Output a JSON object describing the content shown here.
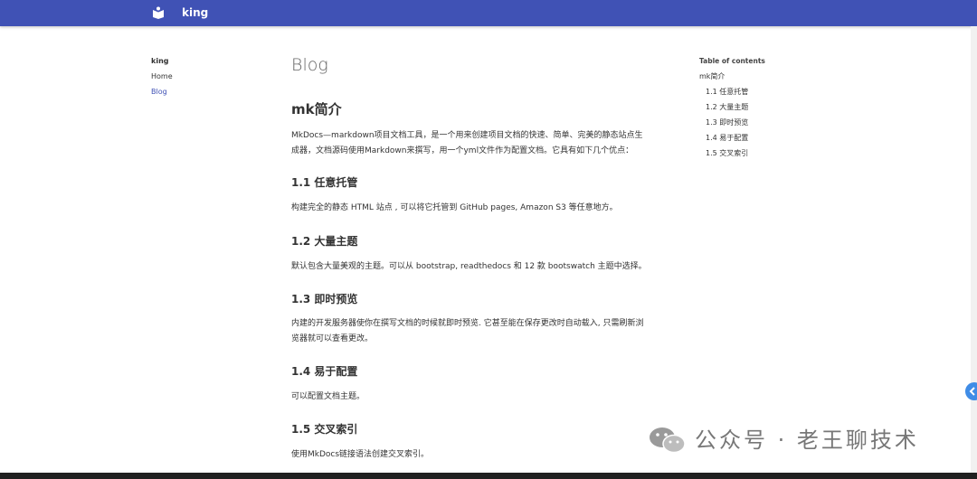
{
  "header": {
    "site_name": "king"
  },
  "nav": {
    "title": "king",
    "items": [
      {
        "label": "Home"
      },
      {
        "label": "Blog"
      }
    ]
  },
  "content": {
    "page_title": "Blog",
    "heading": "mk简介",
    "intro_line1": "MkDocs—markdown项目文档工具，是一个用来创建项目文档的快速、简单、完美的静态站点生",
    "intro_line2": "成器，文档源码使用Markdown来撰写，用一个yml文件作为配置文档。它具有如下几个优点：",
    "sections": [
      {
        "title": "1.1 任意托管",
        "text": [
          "构建完全的静态 HTML 站点 , 可以将它托管到 GitHub pages, Amazon S3 等任意地方。"
        ]
      },
      {
        "title": "1.2 大量主题",
        "text": [
          "默认包含大量美观的主题。可以从 bootstrap, readthedocs 和 12 款 bootswatch 主题中选择。"
        ]
      },
      {
        "title": "1.3 即时预览",
        "text": [
          "内建的开发服务器使你在撰写文档的时候就即时预览. 它甚至能在保存更改时自动载入, 只需刷新浏",
          "览器就可以查看更改。"
        ]
      },
      {
        "title": "1.4 易于配置",
        "text": [
          "可以配置文档主题。"
        ]
      },
      {
        "title": "1.5 交叉索引",
        "text": [
          "使用MkDocs链接语法创建交叉索引。"
        ]
      }
    ]
  },
  "toc": {
    "title": "Table of contents",
    "items": [
      "mk简介",
      "1.1 任意托管",
      "1.2 大量主题",
      "1.3 即时预览",
      "1.4 易于配置",
      "1.5 交叉索引"
    ]
  },
  "watermark": {
    "text": "公众号 · 老王聊技术"
  },
  "colors": {
    "header": "#4052b5",
    "active_link": "#4052b5"
  }
}
